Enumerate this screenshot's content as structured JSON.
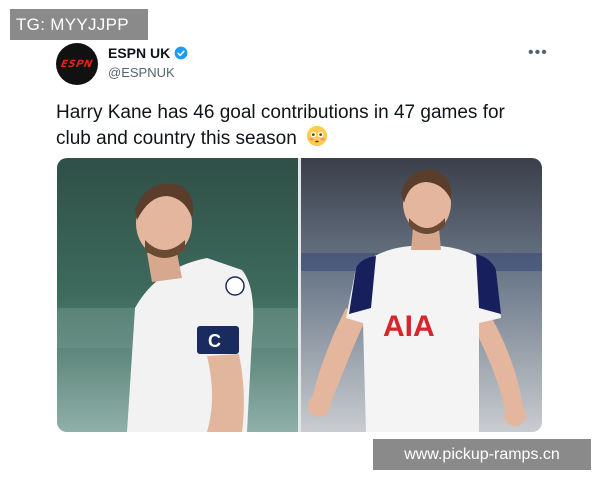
{
  "watermarks": {
    "top": "TG: MYYJJPP",
    "bottom": "www.pickup-ramps.cn"
  },
  "account": {
    "display_name": "ESPN UK",
    "handle": "@ESPNUK",
    "verified": true,
    "avatar_logo": "ESPN"
  },
  "tweet": {
    "text": "Harry Kane has 46 goal contributions in 47 games for club and country this season",
    "emoji": "flushed-face-emoji"
  },
  "media": {
    "photos": [
      {
        "name": "england-kit-photo",
        "captain_band": "C"
      },
      {
        "name": "tottenham-kit-photo",
        "sponsor": "AIA"
      }
    ]
  },
  "colors": {
    "verified_blue": "#1d9bf0",
    "espn_red": "#e2231a",
    "text_primary": "#0f1419",
    "text_secondary": "#536471"
  }
}
